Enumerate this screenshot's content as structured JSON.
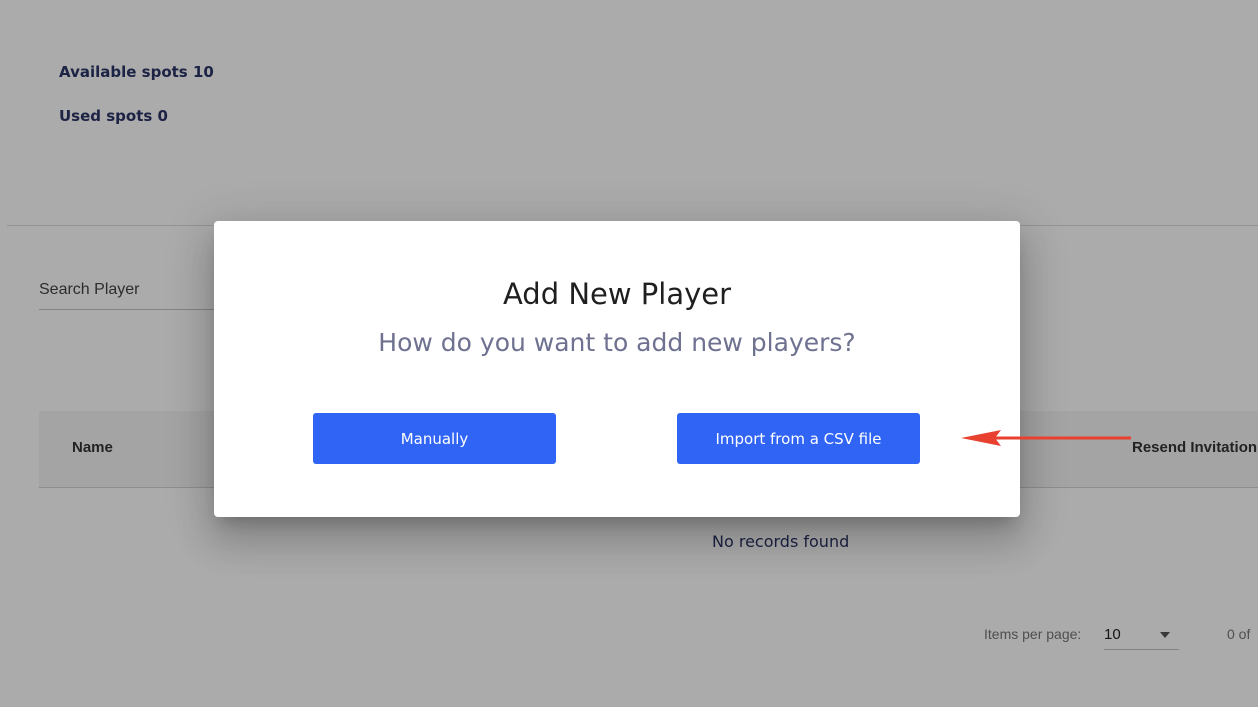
{
  "stats": {
    "available_spots": "Available spots 10",
    "used_spots": "Used spots 0"
  },
  "search": {
    "placeholder": "Search Player"
  },
  "table": {
    "columns": [
      "Name",
      "Resend Invitation"
    ],
    "empty_message": "No records found"
  },
  "paginator": {
    "items_per_page_label": "Items per page:",
    "items_per_page_value": "10",
    "range_label": "0 of"
  },
  "dialog": {
    "title": "Add New Player",
    "subtitle": "How do you want to add new players?",
    "buttons": {
      "manual_label": "Manually",
      "csv_label": "Import from a CSV file"
    }
  },
  "annotation": {
    "arrow_color": "#e8412f"
  },
  "colors": {
    "primary_button": "#2f64f5",
    "stats_text": "#2a3566",
    "overlay": "rgba(0,0,0,0.33)"
  },
  "icons": {
    "dropdown": "chevron-down-icon",
    "annotation": "red-arrow-annotation"
  }
}
